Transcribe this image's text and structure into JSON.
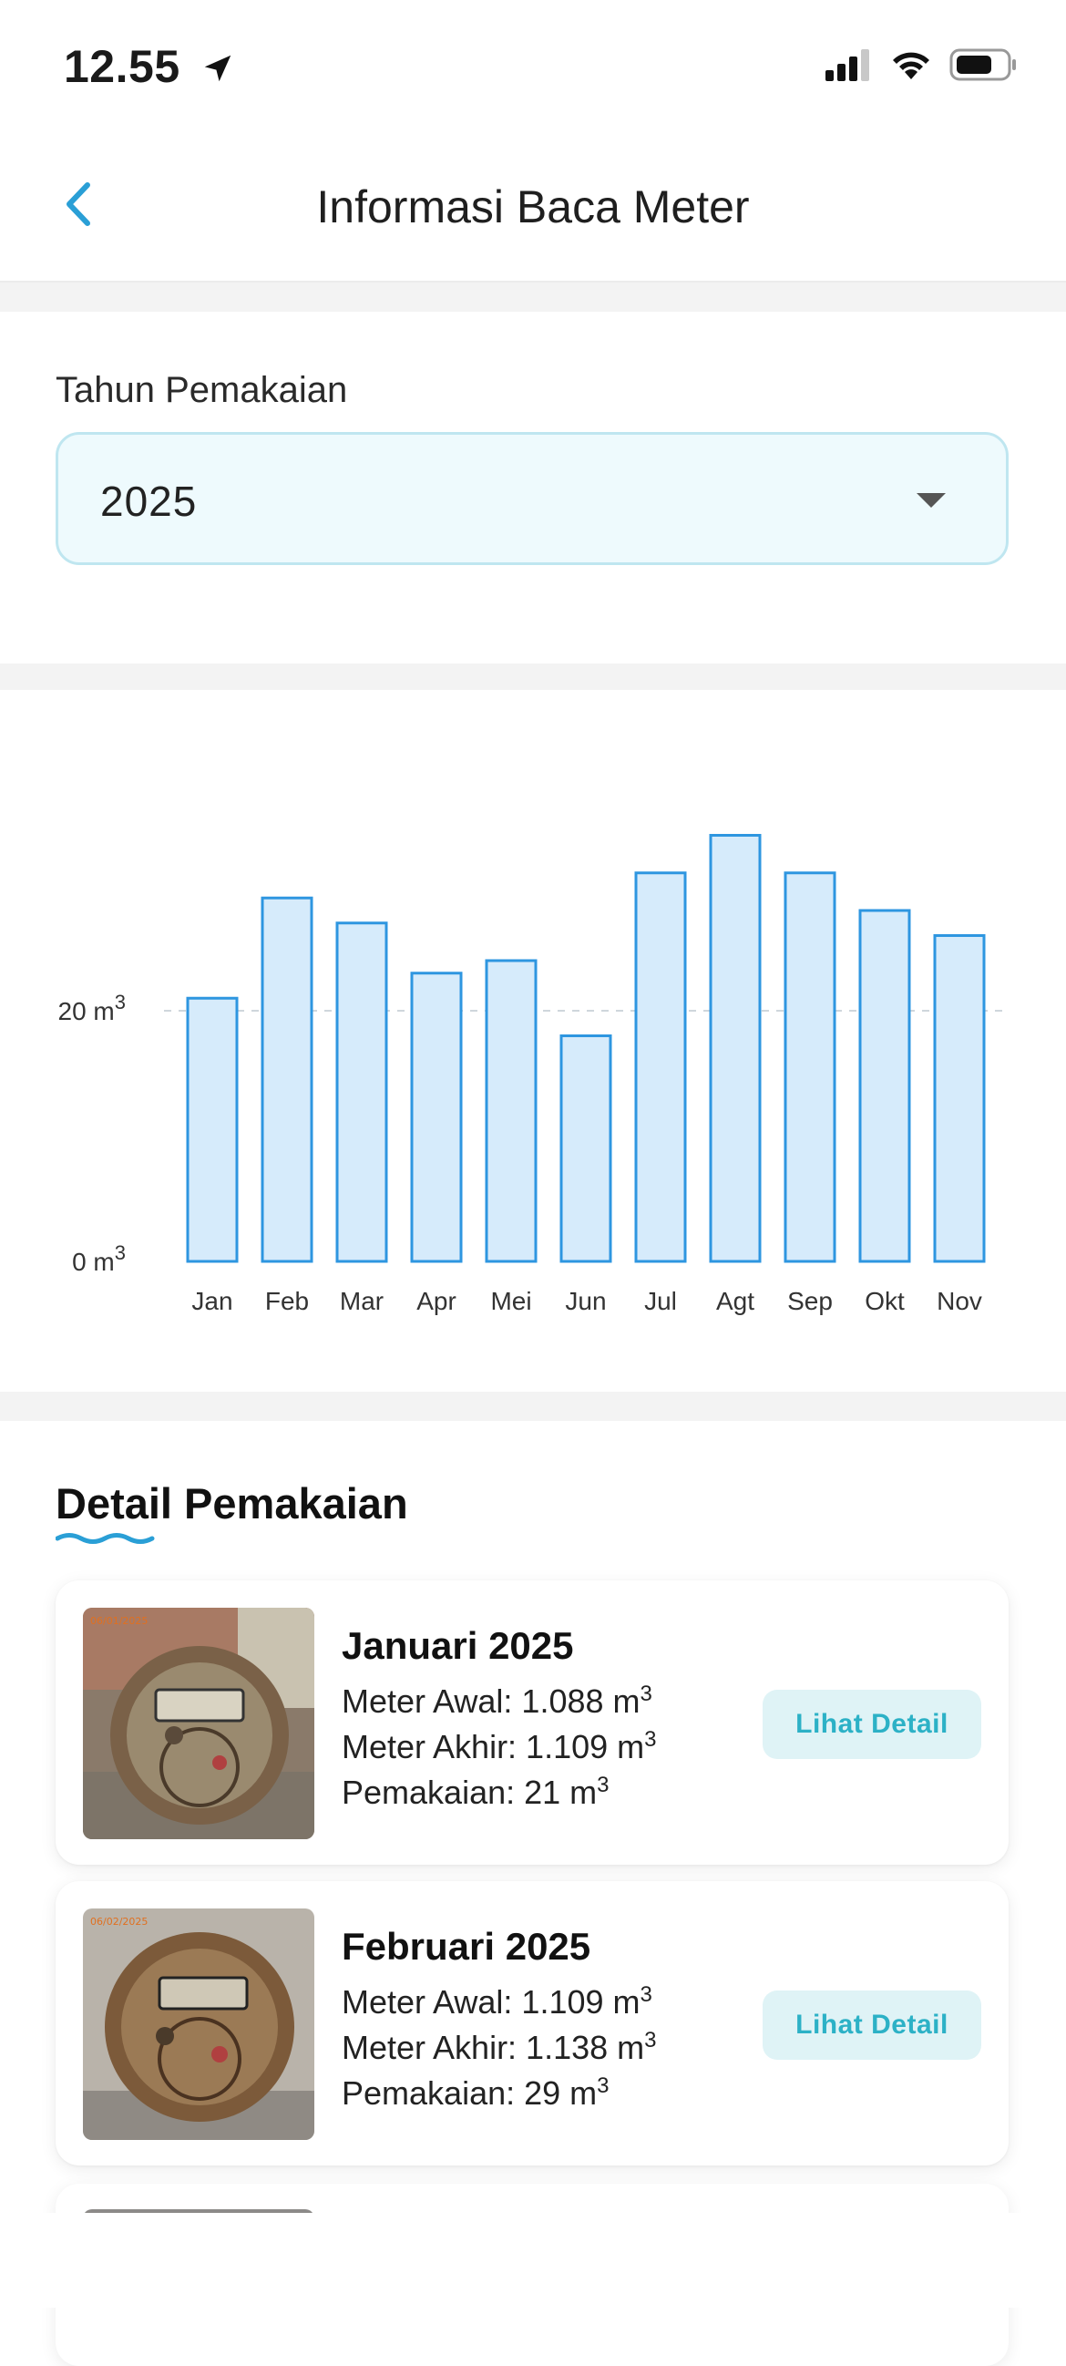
{
  "status": {
    "time": "12.55"
  },
  "header": {
    "title": "Informasi Baca Meter"
  },
  "year_filter": {
    "label": "Tahun Pemakaian",
    "value": "2025"
  },
  "chart_data": {
    "type": "bar",
    "categories": [
      "Jan",
      "Feb",
      "Mar",
      "Apr",
      "Mei",
      "Jun",
      "Jul",
      "Agt",
      "Sep",
      "Okt",
      "Nov"
    ],
    "values": [
      21,
      29,
      27,
      23,
      24,
      18,
      31,
      34,
      31,
      28,
      26
    ],
    "yticks": [
      "0 m",
      "20 m"
    ],
    "unit_superscript": "3",
    "reference_line": 20,
    "grid": false,
    "bar_fill": "#d6ebfb",
    "bar_stroke": "#2e96e0"
  },
  "details": {
    "title": "Detail Pemakaian",
    "accent_color": "#2a9fd6",
    "items": [
      {
        "month": "Januari 2025",
        "meter_awal": "Meter Awal: 1.088 m",
        "meter_akhir": "Meter Akhir: 1.109 m",
        "pemakaian": "Pemakaian: 21 m",
        "sup": "3",
        "button": "Lihat Detail"
      },
      {
        "month": "Februari 2025",
        "meter_awal": "Meter Awal: 1.109 m",
        "meter_akhir": "Meter Akhir: 1.138 m",
        "pemakaian": "Pemakaian: 29 m",
        "sup": "3",
        "button": "Lihat Detail"
      }
    ]
  }
}
